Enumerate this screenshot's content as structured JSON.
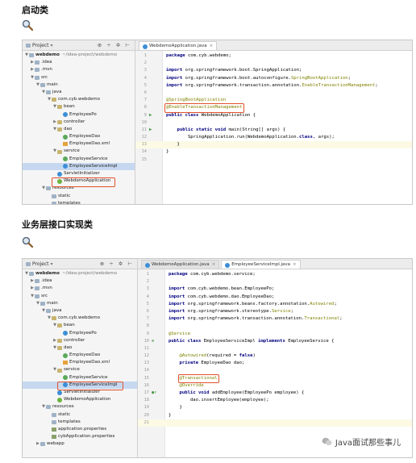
{
  "sections": [
    {
      "heading": "启动类",
      "project_panel": {
        "label": "Project",
        "tree": [
          {
            "indent": 0,
            "arrow": "▼",
            "icon": "folder",
            "text": "webdemo",
            "bold": true,
            "hint": "~/idea-project/webdemo"
          },
          {
            "indent": 1,
            "arrow": "▶",
            "icon": "folder",
            "text": ".idea"
          },
          {
            "indent": 1,
            "arrow": "▶",
            "icon": "folder",
            "text": ".mvn"
          },
          {
            "indent": 1,
            "arrow": "▼",
            "icon": "folder",
            "text": "src"
          },
          {
            "indent": 2,
            "arrow": "▼",
            "icon": "folder",
            "text": "main"
          },
          {
            "indent": 3,
            "arrow": "▼",
            "icon": "folder",
            "text": "java"
          },
          {
            "indent": 4,
            "arrow": "▼",
            "icon": "pkg",
            "text": "com.cyb.webdemo"
          },
          {
            "indent": 5,
            "arrow": "▼",
            "icon": "pkg",
            "text": "bean"
          },
          {
            "indent": 6,
            "arrow": "",
            "icon": "cls",
            "text": "EmployeePo"
          },
          {
            "indent": 5,
            "arrow": "▶",
            "icon": "pkg",
            "text": "controller"
          },
          {
            "indent": 5,
            "arrow": "▼",
            "icon": "pkg",
            "text": "dao"
          },
          {
            "indent": 6,
            "arrow": "",
            "icon": "itf",
            "text": "EmployeeDao"
          },
          {
            "indent": 6,
            "arrow": "",
            "icon": "xml",
            "text": "EmployeeDao.xml"
          },
          {
            "indent": 5,
            "arrow": "▼",
            "icon": "pkg",
            "text": "service"
          },
          {
            "indent": 6,
            "arrow": "",
            "icon": "itf",
            "text": "EmployeeService"
          },
          {
            "indent": 6,
            "arrow": "",
            "icon": "cls",
            "text": "EmployeeServiceImpl",
            "selected": true
          },
          {
            "indent": 5,
            "arrow": "",
            "icon": "cls",
            "text": "ServletInitializer"
          },
          {
            "indent": 5,
            "arrow": "",
            "icon": "spring",
            "text": "WebdemoApplication",
            "highlight": true
          },
          {
            "indent": 3,
            "arrow": "▼",
            "icon": "folder",
            "text": "resources"
          },
          {
            "indent": 4,
            "arrow": "",
            "icon": "folder",
            "text": "static"
          },
          {
            "indent": 4,
            "arrow": "",
            "icon": "folder",
            "text": "templates"
          }
        ]
      },
      "tabs": [
        {
          "label": "WebdemoApplication.java",
          "active": true
        }
      ],
      "code": [
        {
          "n": "1",
          "segs": [
            [
              "k",
              "package"
            ],
            [
              "t",
              " com.cyb.webdemo;"
            ]
          ]
        },
        {
          "n": "2",
          "segs": []
        },
        {
          "n": "3",
          "segs": [
            [
              "k",
              "import"
            ],
            [
              "t",
              " org.springframework.boot.SpringApplication;"
            ]
          ]
        },
        {
          "n": "4",
          "segs": [
            [
              "k",
              "import"
            ],
            [
              "t",
              " org.springframework.boot.autoconfigure."
            ],
            [
              "a",
              "SpringBootApplication"
            ],
            [
              "t",
              ";"
            ]
          ]
        },
        {
          "n": "5",
          "segs": [
            [
              "k",
              "import"
            ],
            [
              "t",
              " org.springframework.transaction.annotation."
            ],
            [
              "a",
              "EnableTransactionManagement"
            ],
            [
              "t",
              ";"
            ]
          ]
        },
        {
          "n": "6",
          "segs": []
        },
        {
          "n": "7",
          "segs": [
            [
              "a",
              "@SpringBootApplication"
            ]
          ]
        },
        {
          "n": "8",
          "segs": [
            [
              "a",
              "@EnableTransactionManagement"
            ]
          ],
          "highlight": true
        },
        {
          "n": "9",
          "mark": "▶",
          "segs": [
            [
              "k",
              "public class"
            ],
            [
              "t",
              " WebdemoApplication {"
            ]
          ]
        },
        {
          "n": "10",
          "segs": []
        },
        {
          "n": "11",
          "mark": "▶",
          "segs": [
            [
              "t",
              "    "
            ],
            [
              "k",
              "public static void"
            ],
            [
              "t",
              " main(String[] args) {"
            ]
          ]
        },
        {
          "n": "12",
          "segs": [
            [
              "t",
              "        SpringApplication."
            ],
            [
              "t",
              "run"
            ],
            [
              "t",
              "(WebdemoApplication."
            ],
            [
              "k",
              "class"
            ],
            [
              "t",
              ", args);"
            ]
          ]
        },
        {
          "n": "13",
          "segs": [
            [
              "t",
              "    }"
            ]
          ],
          "current": true
        },
        {
          "n": "14",
          "segs": [
            [
              "t",
              "}"
            ]
          ]
        },
        {
          "n": "15",
          "segs": []
        }
      ]
    },
    {
      "heading": "业务层接口实现类",
      "project_panel": {
        "label": "Project",
        "tree": [
          {
            "indent": 0,
            "arrow": "▼",
            "icon": "folder",
            "text": "webdemo",
            "bold": true,
            "hint": "~/idea-project/webdemo"
          },
          {
            "indent": 1,
            "arrow": "▶",
            "icon": "folder",
            "text": ".idea"
          },
          {
            "indent": 1,
            "arrow": "▶",
            "icon": "folder",
            "text": ".mvn"
          },
          {
            "indent": 1,
            "arrow": "▼",
            "icon": "folder",
            "text": "src"
          },
          {
            "indent": 2,
            "arrow": "▼",
            "icon": "folder",
            "text": "main"
          },
          {
            "indent": 3,
            "arrow": "▼",
            "icon": "folder",
            "text": "java"
          },
          {
            "indent": 4,
            "arrow": "▼",
            "icon": "pkg",
            "text": "com.cyb.webdemo"
          },
          {
            "indent": 5,
            "arrow": "▼",
            "icon": "pkg",
            "text": "bean"
          },
          {
            "indent": 6,
            "arrow": "",
            "icon": "cls",
            "text": "EmployeePo"
          },
          {
            "indent": 5,
            "arrow": "▶",
            "icon": "pkg",
            "text": "controller"
          },
          {
            "indent": 5,
            "arrow": "▼",
            "icon": "pkg",
            "text": "dao"
          },
          {
            "indent": 6,
            "arrow": "",
            "icon": "itf",
            "text": "EmployeeDao"
          },
          {
            "indent": 6,
            "arrow": "",
            "icon": "xml",
            "text": "EmployeeDao.xml"
          },
          {
            "indent": 5,
            "arrow": "▼",
            "icon": "pkg",
            "text": "service"
          },
          {
            "indent": 6,
            "arrow": "",
            "icon": "itf",
            "text": "EmployeeService"
          },
          {
            "indent": 6,
            "arrow": "",
            "icon": "cls",
            "text": "EmployeeServiceImpl",
            "selected": true,
            "highlight": true
          },
          {
            "indent": 5,
            "arrow": "",
            "icon": "cls",
            "text": "ServletInitializer"
          },
          {
            "indent": 5,
            "arrow": "",
            "icon": "spring",
            "text": "WebdemoApplication"
          },
          {
            "indent": 3,
            "arrow": "▼",
            "icon": "folder",
            "text": "resources"
          },
          {
            "indent": 4,
            "arrow": "",
            "icon": "folder",
            "text": "static"
          },
          {
            "indent": 4,
            "arrow": "",
            "icon": "folder",
            "text": "templates"
          },
          {
            "indent": 4,
            "arrow": "",
            "icon": "prop",
            "text": "application.properties"
          },
          {
            "indent": 4,
            "arrow": "",
            "icon": "prop",
            "text": "cybApplication.properties"
          },
          {
            "indent": 2,
            "arrow": "▶",
            "icon": "folder",
            "text": "webapp"
          }
        ]
      },
      "tabs": [
        {
          "label": "WebdemoApplication.java",
          "active": false
        },
        {
          "label": "EmployeeServiceImpl.java",
          "active": true
        }
      ],
      "code": [
        {
          "n": "1",
          "segs": [
            [
              "k",
              "package"
            ],
            [
              "t",
              " com.cyb.webdemo.service;"
            ]
          ]
        },
        {
          "n": "2",
          "segs": []
        },
        {
          "n": "3",
          "segs": [
            [
              "k",
              "import"
            ],
            [
              "t",
              " com.cyb.webdemo.bean.EmployeePo;"
            ]
          ]
        },
        {
          "n": "4",
          "segs": [
            [
              "k",
              "import"
            ],
            [
              "t",
              " com.cyb.webdemo.dao.EmployeeDao;"
            ]
          ]
        },
        {
          "n": "5",
          "segs": [
            [
              "k",
              "import"
            ],
            [
              "t",
              " org.springframework.beans.factory.annotation."
            ],
            [
              "a",
              "Autowired"
            ],
            [
              "t",
              ";"
            ]
          ]
        },
        {
          "n": "6",
          "segs": [
            [
              "k",
              "import"
            ],
            [
              "t",
              " org.springframework.stereotype."
            ],
            [
              "a",
              "Service"
            ],
            [
              "t",
              ";"
            ]
          ]
        },
        {
          "n": "7",
          "segs": [
            [
              "k",
              "import"
            ],
            [
              "t",
              " org.springframework.transaction.annotation."
            ],
            [
              "a",
              "Transactional"
            ],
            [
              "t",
              ";"
            ]
          ]
        },
        {
          "n": "8",
          "segs": []
        },
        {
          "n": "9",
          "segs": [
            [
              "a",
              "@Service"
            ]
          ]
        },
        {
          "n": "10",
          "mark": "⊕",
          "segs": [
            [
              "k",
              "public class"
            ],
            [
              "t",
              " EmployeeServiceImpl "
            ],
            [
              "k",
              "implements"
            ],
            [
              "t",
              " EmployeeService {"
            ]
          ]
        },
        {
          "n": "11",
          "segs": []
        },
        {
          "n": "12",
          "segs": [
            [
              "t",
              "    "
            ],
            [
              "a",
              "@Autowired"
            ],
            [
              "t",
              "(required = "
            ],
            [
              "k",
              "false"
            ],
            [
              "t",
              ")"
            ]
          ]
        },
        {
          "n": "13",
          "segs": [
            [
              "t",
              "    "
            ],
            [
              "k",
              "private"
            ],
            [
              "t",
              " EmployeeDao dao;"
            ]
          ]
        },
        {
          "n": "14",
          "segs": []
        },
        {
          "n": "15",
          "segs": [
            [
              "t",
              "    "
            ],
            [
              "a",
              "@Transactional"
            ]
          ],
          "highlight": true
        },
        {
          "n": "16",
          "segs": [
            [
              "t",
              "    "
            ],
            [
              "a",
              "@Override"
            ]
          ]
        },
        {
          "n": "17",
          "mark": "●↑",
          "segs": [
            [
              "t",
              "    "
            ],
            [
              "k",
              "public void"
            ],
            [
              "t",
              " addEmployee(EmployeePo employee) {"
            ]
          ]
        },
        {
          "n": "18",
          "segs": [
            [
              "t",
              "        dao.insertEmployee(employee);"
            ]
          ]
        },
        {
          "n": "19",
          "segs": [
            [
              "t",
              "    }"
            ]
          ]
        },
        {
          "n": "20",
          "segs": [
            [
              "t",
              "}"
            ]
          ]
        },
        {
          "n": "21",
          "segs": [],
          "current": true
        }
      ]
    }
  ],
  "watermark": "Java面试那些事儿",
  "colors": {
    "highlight": "#e0522d",
    "keyword": "#000080",
    "annotation": "#808000"
  }
}
